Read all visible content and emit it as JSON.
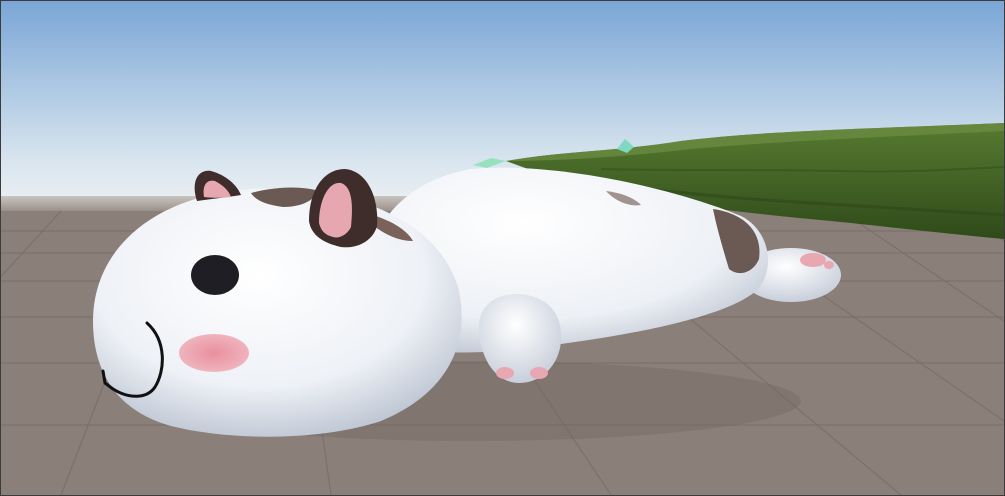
{
  "scene": {
    "view": "Game",
    "objects": [
      {
        "name": "sky",
        "icon": "sky"
      },
      {
        "name": "ground-grid-plane",
        "icon": "grid-floor"
      },
      {
        "name": "grass-hill-terrain",
        "icon": "terrain"
      },
      {
        "name": "cat-character",
        "icon": "cat-plush"
      }
    ],
    "colors": {
      "sky_top": "#7aa6d6",
      "sky_horizon": "#e4ecf2",
      "ground": "#8b7f79",
      "grid_line": "#776b66",
      "grass": "#4a6e2a",
      "grass_dark": "#2c4418",
      "cat_body": "#eef1f6",
      "cat_shadow": "#b9c2d2",
      "cat_patch": "#6b5a54",
      "ear_dark": "#3e2d2a",
      "ear_inner": "#e6a7b1",
      "blush": "#e79aa6",
      "eye": "#1e1e24",
      "mouth": "#111111",
      "paw_pad": "#e7a8b2",
      "crystal": "#7fd8c0"
    }
  }
}
